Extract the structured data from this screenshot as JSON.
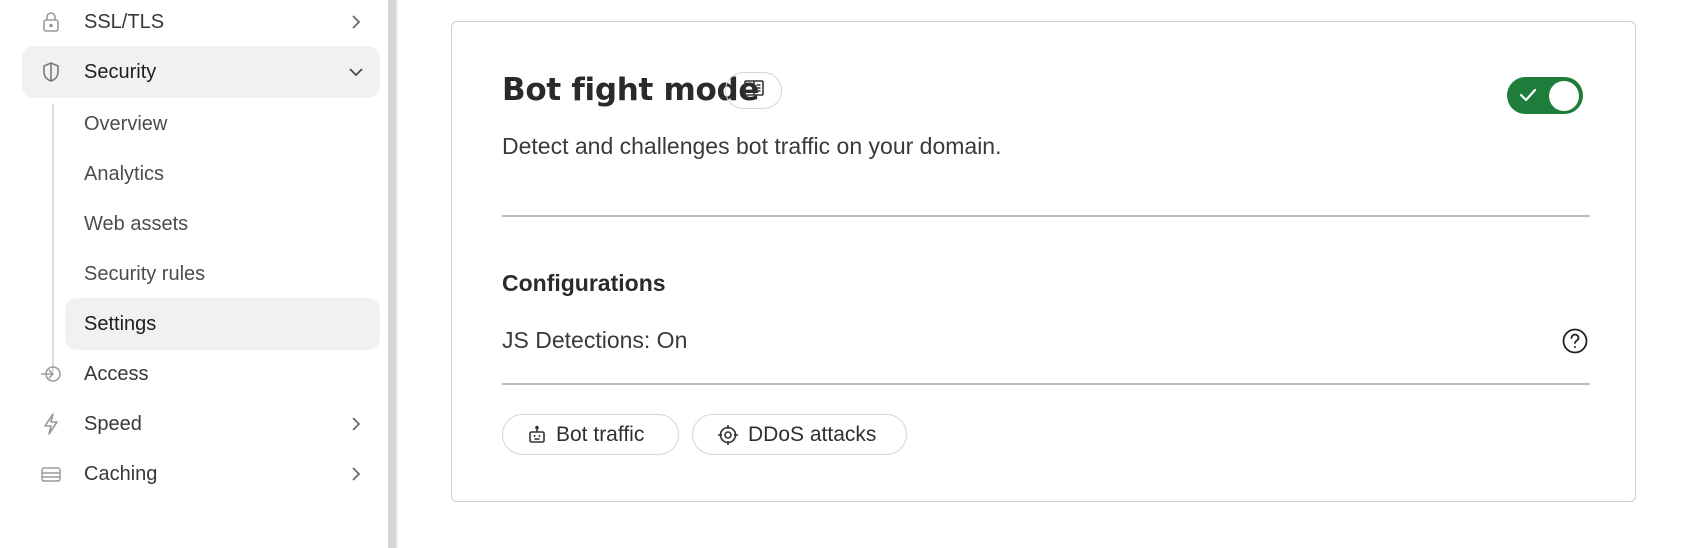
{
  "sidebar": {
    "items": [
      {
        "label": "SSL/TLS",
        "icon": "lock-icon"
      },
      {
        "label": "Security",
        "icon": "shield-icon"
      },
      {
        "label": "Access",
        "icon": "access-icon"
      },
      {
        "label": "Speed",
        "icon": "bolt-icon"
      },
      {
        "label": "Caching",
        "icon": "storage-icon"
      }
    ],
    "security_sub": [
      {
        "label": "Overview"
      },
      {
        "label": "Analytics"
      },
      {
        "label": "Web assets"
      },
      {
        "label": "Security rules"
      },
      {
        "label": "Settings"
      }
    ]
  },
  "card": {
    "title": "Bot fight mode",
    "description": "Detect and challenges bot traffic on your domain.",
    "toggle_on": true,
    "config_title": "Configurations",
    "js_detections": "JS Detections: On",
    "chips": [
      {
        "label": "Bot traffic",
        "icon": "robot-icon"
      },
      {
        "label": "DDoS attacks",
        "icon": "target-icon"
      }
    ]
  },
  "colors": {
    "toggle_on": "#1e7d3a",
    "active_bg": "#f1f1f1",
    "border": "#cfcfcf"
  }
}
